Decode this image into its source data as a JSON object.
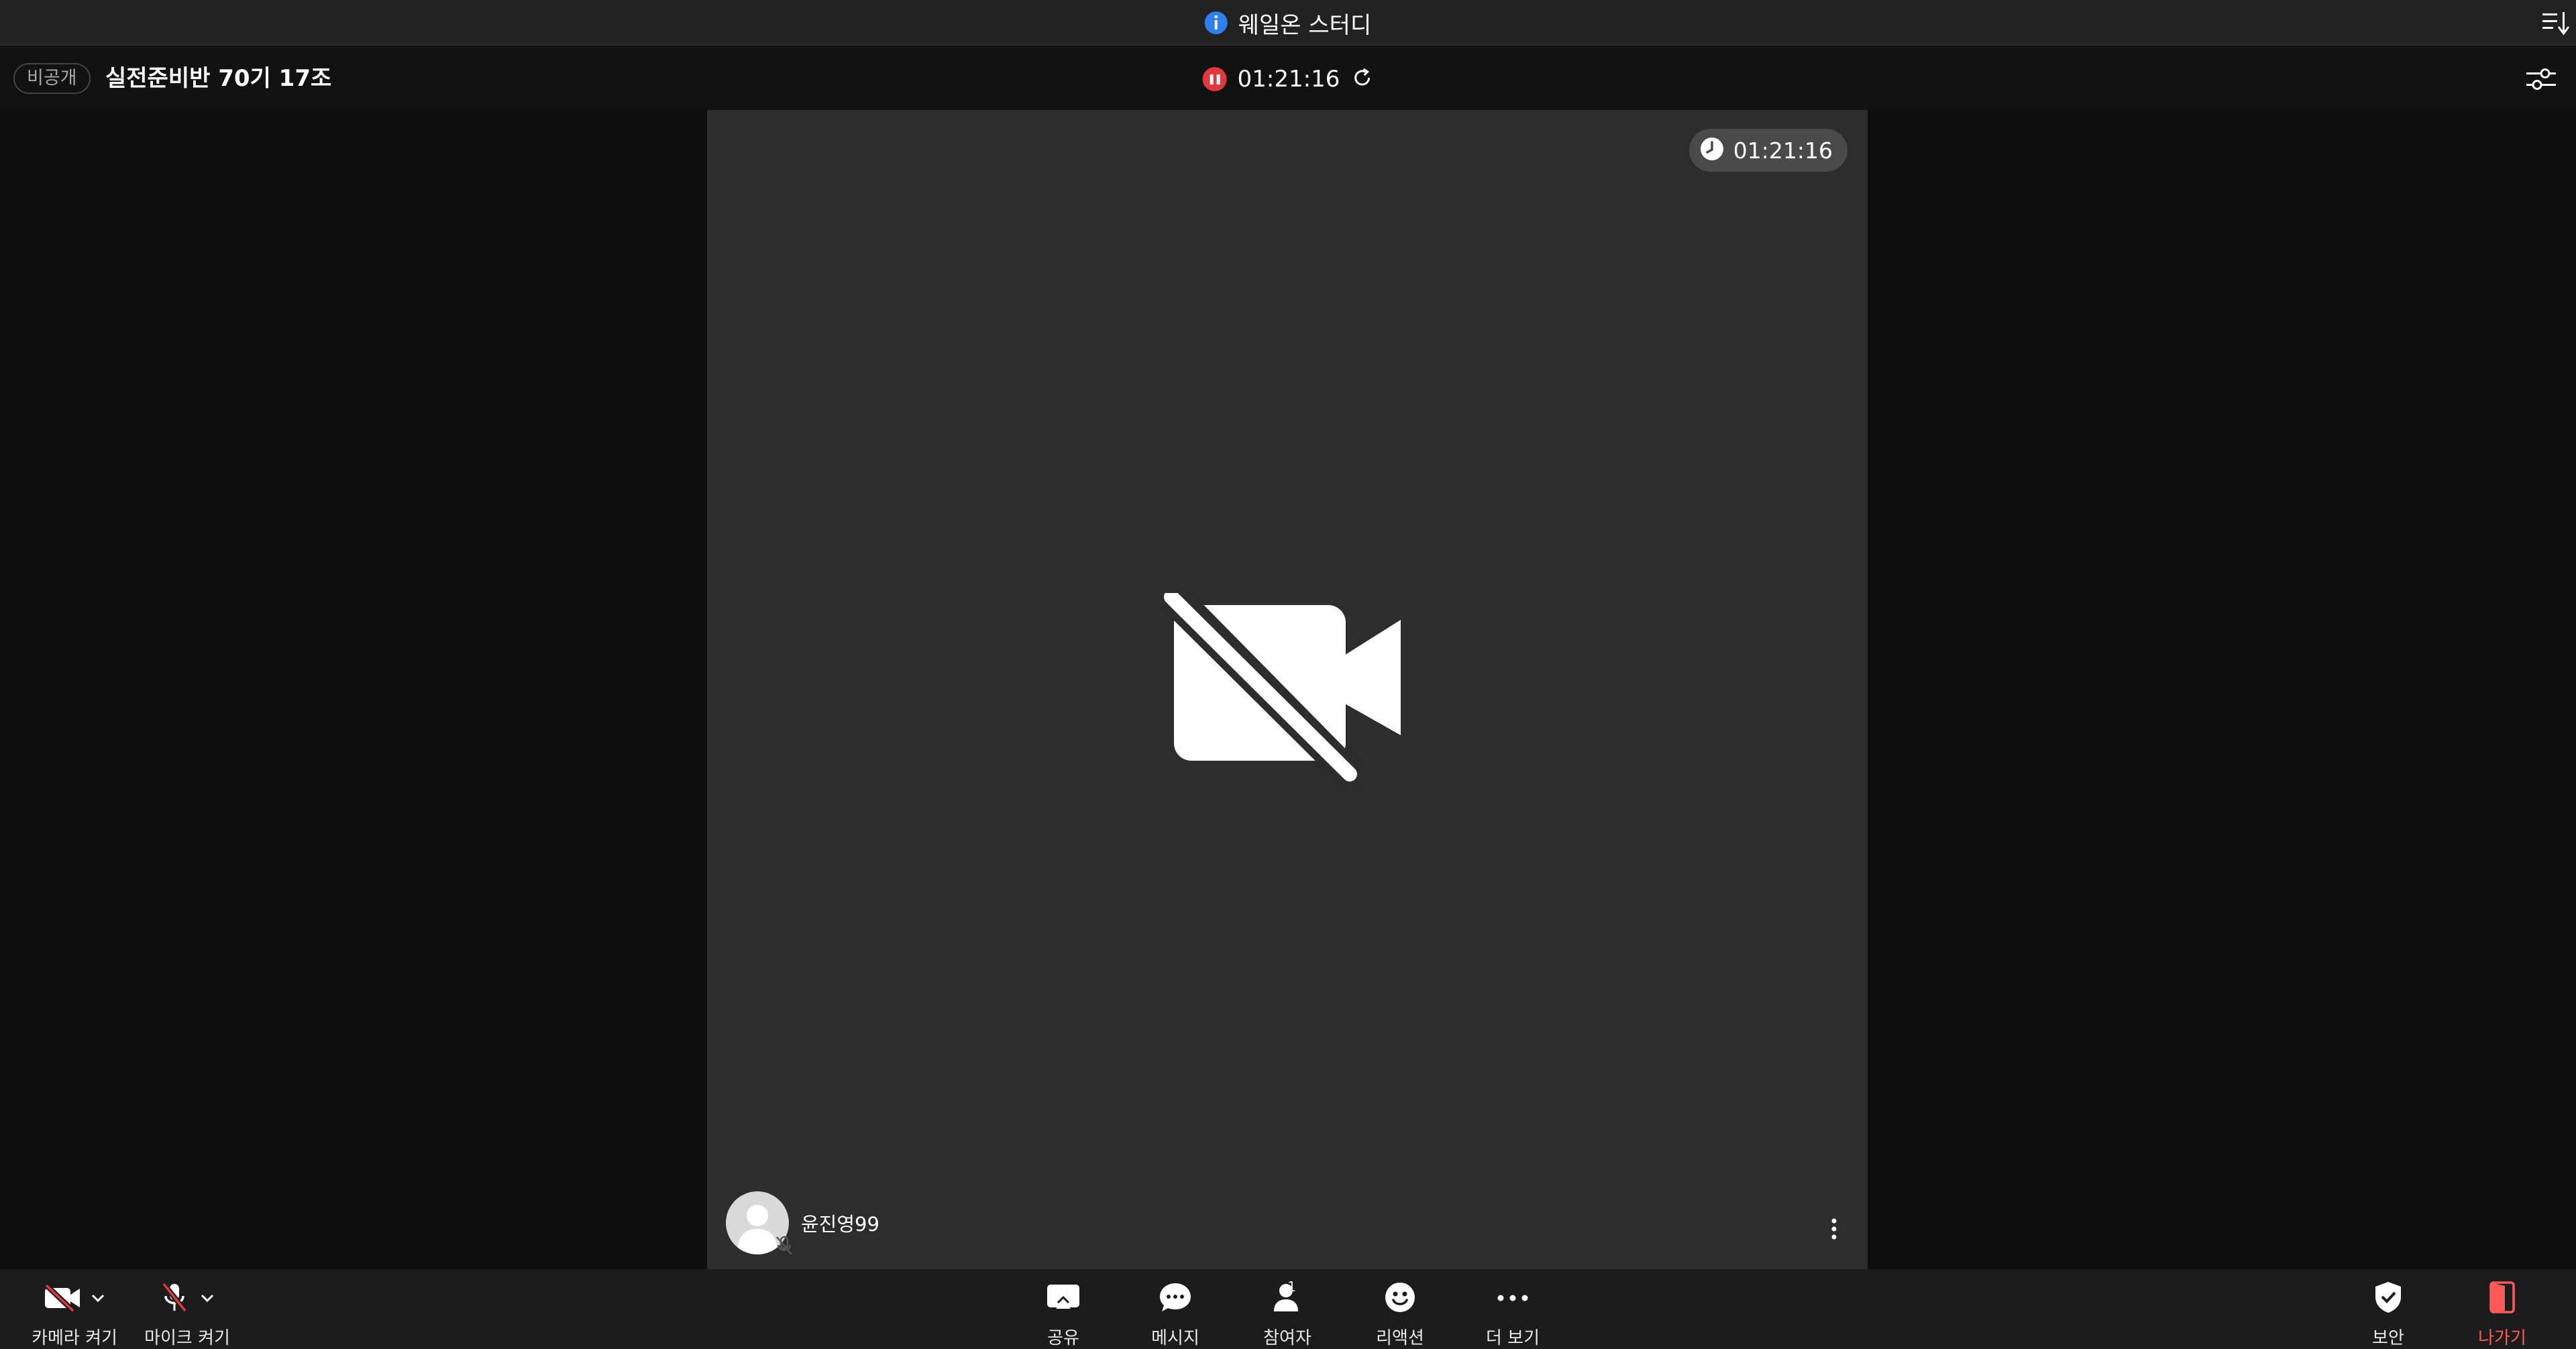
{
  "titlebar": {
    "title": "웨일온 스터디"
  },
  "header": {
    "visibility_badge": "비공개",
    "room_title": "실전준비반 70기 17조",
    "recording_time": "01:21:16"
  },
  "stage": {
    "timer": "01:21:16",
    "participant_name": "윤진영99"
  },
  "toolbar": {
    "camera_label": "카메라 켜기",
    "mic_label": "마이크 켜기",
    "share_label": "공유",
    "message_label": "메시지",
    "participants_label": "참여자",
    "participants_count": "1",
    "reaction_label": "리액션",
    "more_label": "더 보기",
    "security_label": "보안",
    "leave_label": "나가기"
  },
  "colors": {
    "accent_blue": "#2f80ed",
    "recording_red": "#e0383e",
    "leave_red": "#ff5a5a",
    "stage_bg": "#2d2d2d"
  }
}
